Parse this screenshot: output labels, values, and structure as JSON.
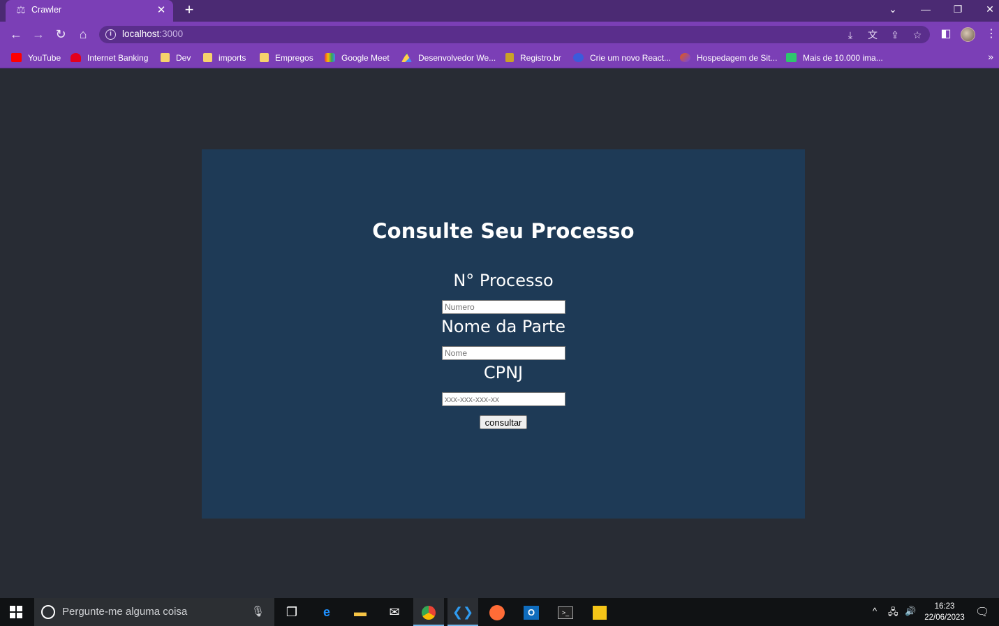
{
  "browser": {
    "tab_title": "Crawler",
    "new_tab_symbol": "+",
    "close_symbol": "✕",
    "url_host": "localhost",
    "url_port": ":3000",
    "bookmarks": [
      {
        "label": "YouTube",
        "icon": "youtube-icon",
        "color": "#ff0000"
      },
      {
        "label": "Internet Banking",
        "icon": "bank-icon",
        "color": "#e3001b"
      },
      {
        "label": "Dev",
        "icon": "folder-icon",
        "color": "#f6d36b"
      },
      {
        "label": "imports",
        "icon": "folder-icon",
        "color": "#f6d36b"
      },
      {
        "label": "Empregos",
        "icon": "folder-icon",
        "color": "#f6d36b"
      },
      {
        "label": "Google Meet",
        "icon": "google-meet-icon",
        "color": "#00ac47"
      },
      {
        "label": "Desenvolvedor We...",
        "icon": "google-drive-icon",
        "color": "#1fa463"
      },
      {
        "label": "Registro.br",
        "icon": "registro-icon",
        "color": "#c9a227"
      },
      {
        "label": "Crie um novo React...",
        "icon": "react-icon",
        "color": "#3b5bdb"
      },
      {
        "label": "Hospedagem de Sit...",
        "icon": "hosting-icon",
        "color": "#e8590c"
      },
      {
        "label": "Mais de 10.000 ima...",
        "icon": "pixabay-icon",
        "color": "#2ec66d"
      }
    ]
  },
  "page": {
    "title": "Consulte Seu Processo",
    "fields": [
      {
        "label": "N° Processo",
        "placeholder": "Numero"
      },
      {
        "label": "Nome da Parte",
        "placeholder": "Nome"
      },
      {
        "label": "CPNJ",
        "placeholder": "xxx-xxx-xxx-xx"
      }
    ],
    "submit_label": "consultar"
  },
  "taskbar": {
    "search_placeholder": "Pergunte-me alguma coisa",
    "time": "16:23",
    "date": "22/06/2023"
  },
  "colors": {
    "browser_accent": "#7b3fb6",
    "page_background": "#282c34",
    "card_background": "#1e3a56"
  }
}
